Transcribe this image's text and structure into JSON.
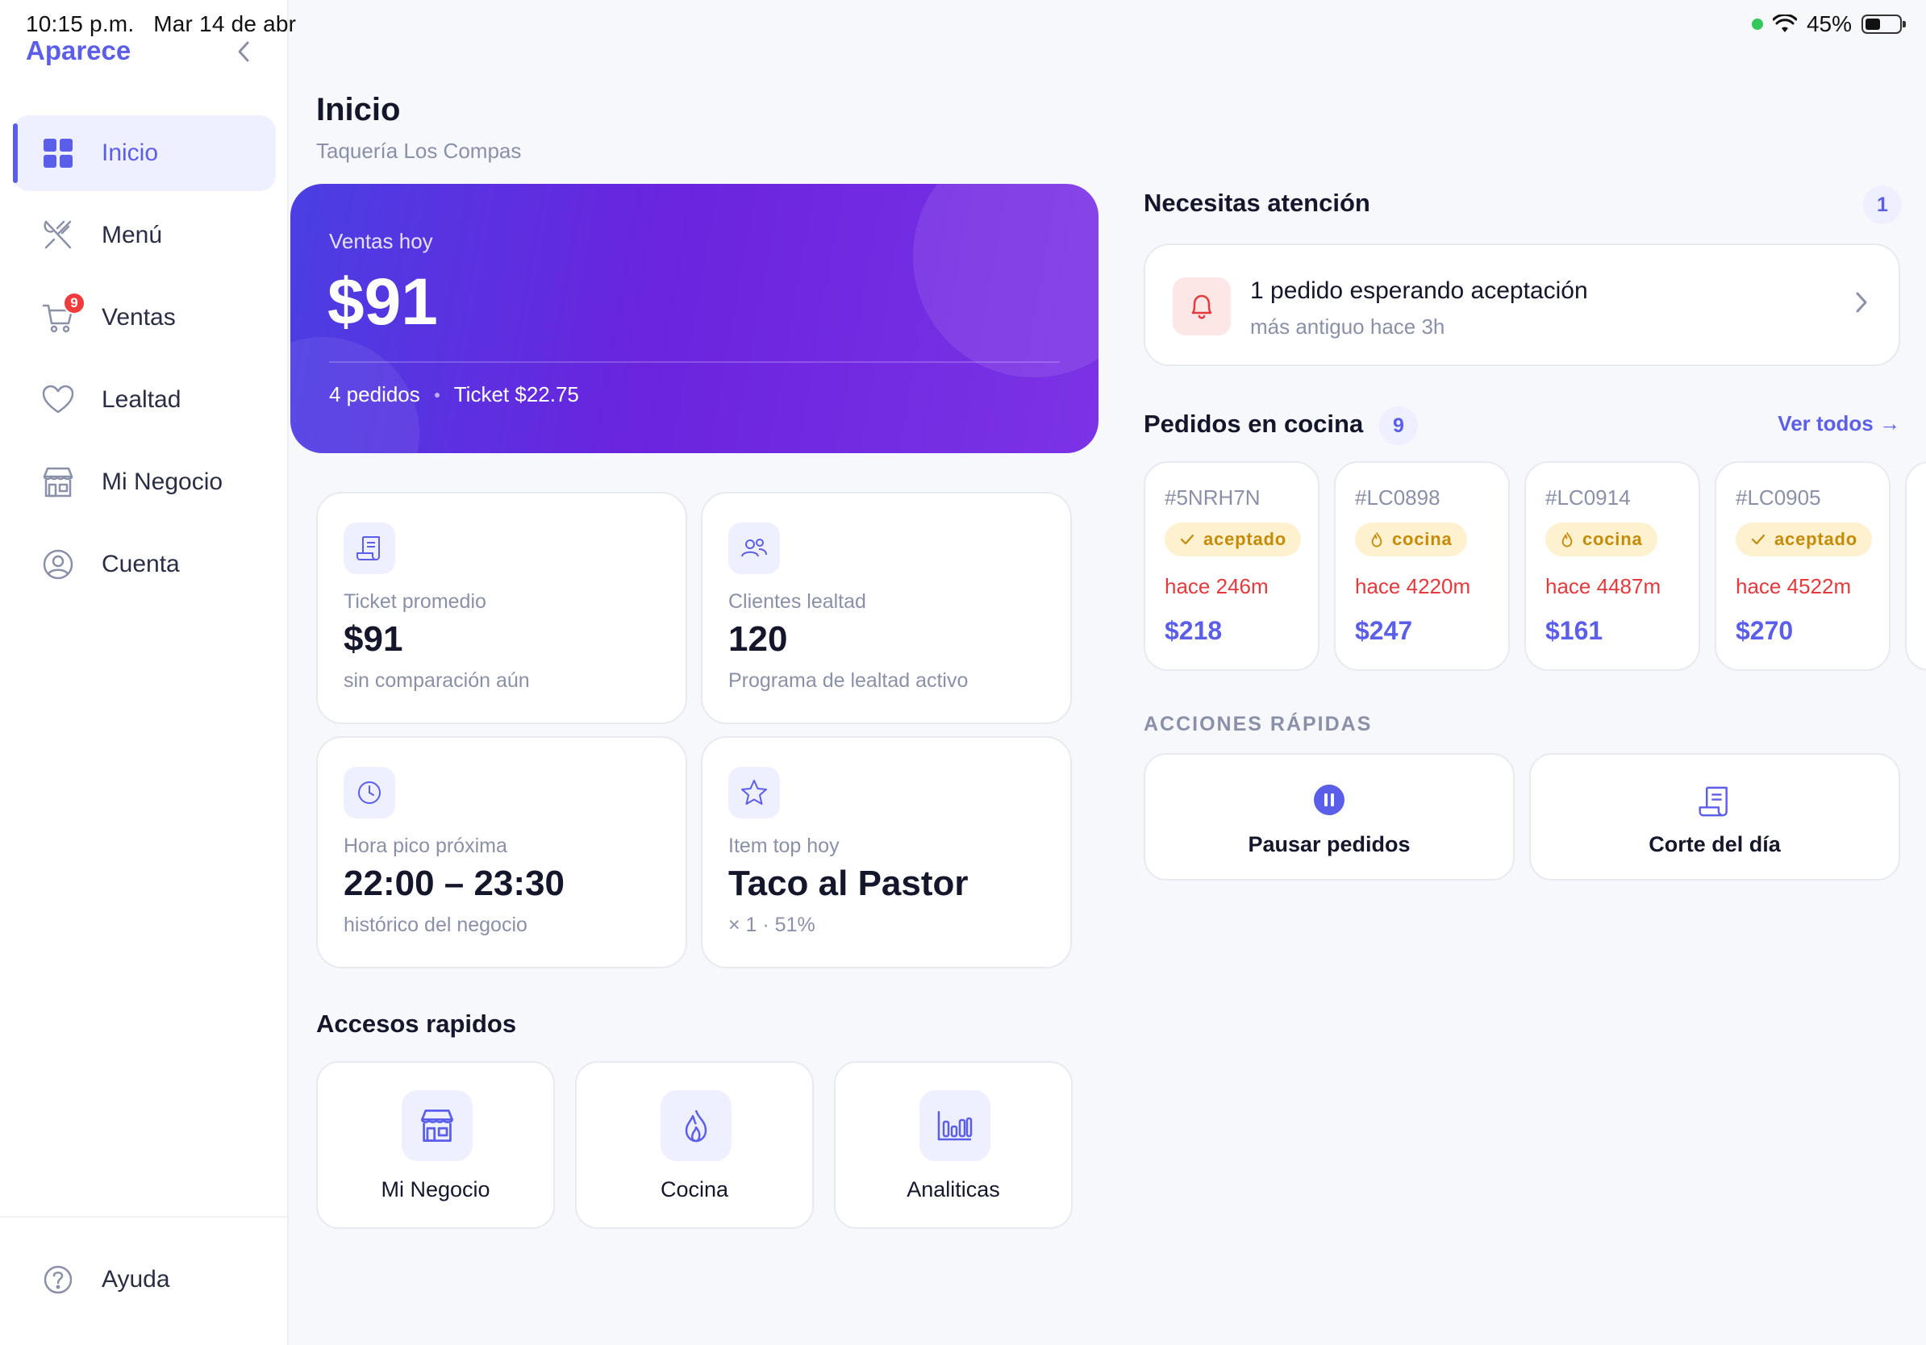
{
  "status_bar": {
    "time": "10:15 p.m.   Mar 14 de abr",
    "battery": "45%"
  },
  "sidebar": {
    "brand": "Aparece",
    "items": [
      {
        "label": "Inicio",
        "icon": "grid-icon",
        "active": true
      },
      {
        "label": "Menú",
        "icon": "utensils-icon"
      },
      {
        "label": "Ventas",
        "icon": "cart-icon",
        "badge": "9"
      },
      {
        "label": "Lealtad",
        "icon": "heart-icon"
      },
      {
        "label": "Mi Negocio",
        "icon": "store-icon"
      },
      {
        "label": "Cuenta",
        "icon": "user-circle-icon"
      }
    ],
    "help": "Ayuda"
  },
  "header": {
    "title": "Inicio",
    "subtitle": "Taquería Los Compas"
  },
  "hero": {
    "label": "Ventas hoy",
    "value": "$91",
    "orders": "4 pedidos",
    "ticket": "Ticket $22.75"
  },
  "stats": [
    {
      "label": "Ticket promedio",
      "value": "$91",
      "sub": "sin comparación aún",
      "icon": "receipt-icon"
    },
    {
      "label": "Clientes lealtad",
      "value": "120",
      "sub": "Programa de lealtad activo",
      "icon": "users-icon"
    },
    {
      "label": "Hora pico próxima",
      "value": "22:00 – 23:30",
      "sub": "histórico del negocio",
      "icon": "clock-icon"
    },
    {
      "label": "Item top hoy",
      "value": "Taco al Pastor",
      "sub": "× 1 · 51%",
      "icon": "star-icon"
    }
  ],
  "shortcuts": {
    "title": "Accesos rapidos",
    "items": [
      {
        "label": "Mi Negocio",
        "icon": "store-icon"
      },
      {
        "label": "Cocina",
        "icon": "flame-icon"
      },
      {
        "label": "Analiticas",
        "icon": "bar-chart-icon"
      }
    ]
  },
  "attention": {
    "title": "Necesitas atención",
    "count": "1",
    "main": "1 pedido esperando aceptación",
    "sub": "más antiguo hace 3h"
  },
  "kitchen": {
    "title": "Pedidos en cocina",
    "count": "9",
    "link": "Ver todos →",
    "orders": [
      {
        "id": "#5NRH7N",
        "status": "aceptado",
        "status_icon": "check-icon",
        "time": "hace 246m",
        "total": "$218"
      },
      {
        "id": "#LC0898",
        "status": "cocina",
        "status_icon": "flame-icon",
        "time": "hace 4220m",
        "total": "$247"
      },
      {
        "id": "#LC0914",
        "status": "cocina",
        "status_icon": "flame-icon",
        "time": "hace 4487m",
        "total": "$161"
      },
      {
        "id": "#LC0905",
        "status": "aceptado",
        "status_icon": "check-icon",
        "time": "hace 4522m",
        "total": "$270"
      }
    ]
  },
  "quick_actions": {
    "title": "ACCIONES RÁPIDAS",
    "items": [
      {
        "label": "Pausar pedidos",
        "icon": "pause-icon"
      },
      {
        "label": "Corte del día",
        "icon": "receipt-icon"
      }
    ]
  },
  "colors": {
    "accent": "#5b5ee8",
    "danger": "#e5393d",
    "warning_bg": "#fdf1cf",
    "warning_text": "#c58a06"
  }
}
